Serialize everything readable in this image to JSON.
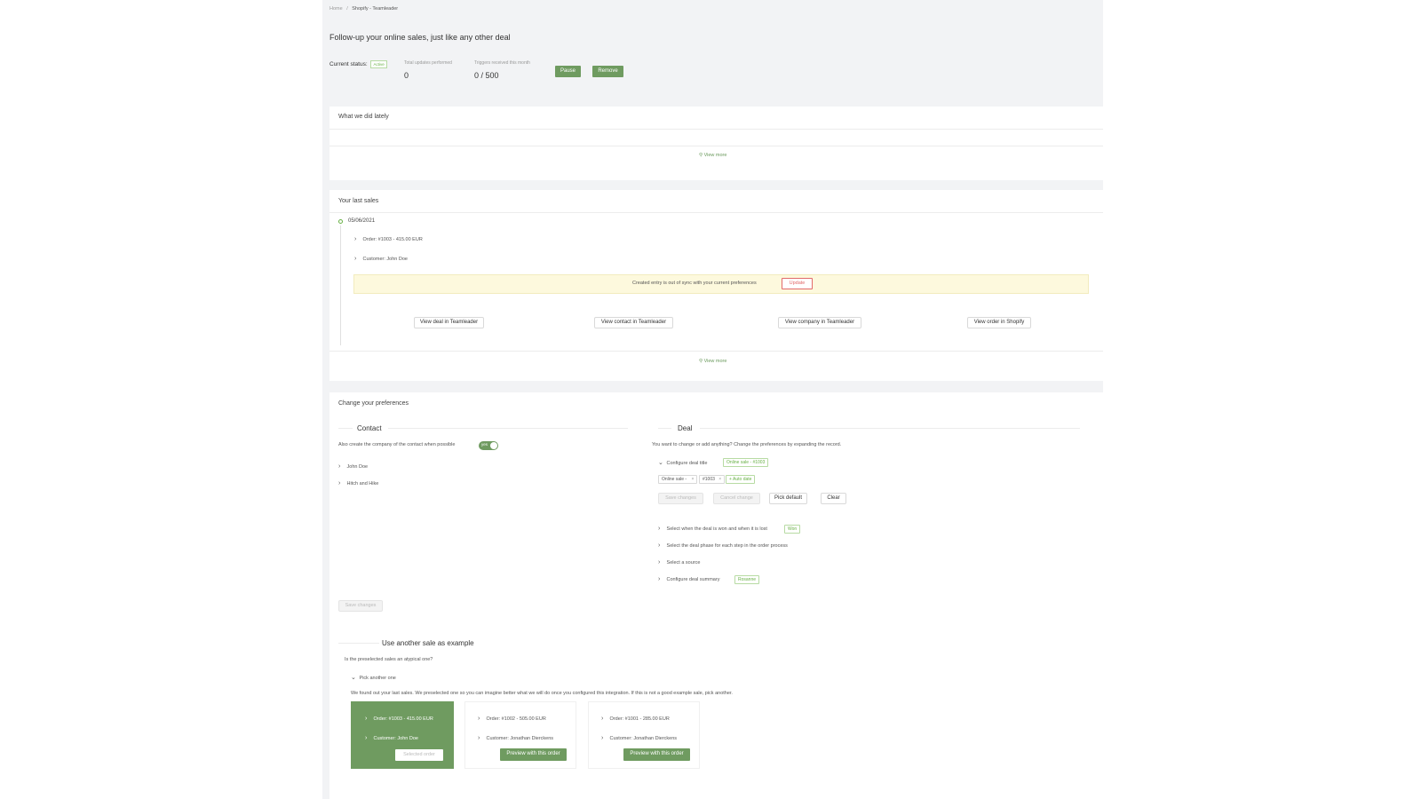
{
  "breadcrumb": {
    "home": "Home",
    "sep": "/",
    "current": "Shopify - Teamleader"
  },
  "page_title": "Follow-up your online sales, just like any other deal",
  "status": {
    "label": "Current status:",
    "badge": "Active",
    "updates_label": "Total updates performed",
    "updates_value": "0",
    "triggers_label": "Triggers received this month",
    "triggers_value": "0 / 500",
    "pause_button": "Pause",
    "remove_button": "Remove"
  },
  "recent": {
    "title": "What we did lately",
    "view_more": "View more"
  },
  "sales": {
    "title": "Your last sales",
    "date": "05/06/2021",
    "order": "Order: #1003 - 415.00 EUR",
    "customer": "Customer: John Doe",
    "sync_warning": "Created entry is out of sync with your current preferences",
    "update_button": "Update",
    "view_deal": "View deal in Teamleader",
    "view_contact": "View contact in Teamleader",
    "view_company": "View company in Teamleader",
    "view_order": "View order in Shopify",
    "view_more": "View more"
  },
  "prefs": {
    "title": "Change your preferences",
    "contact": {
      "heading": "Contact",
      "company_label": "Also create the company of the contact when possible",
      "toggle_label": "yes",
      "items": [
        "John Doe",
        "Hitch and Hike"
      ]
    },
    "deal": {
      "heading": "Deal",
      "intro": "You want to change or add anything? Change the preferences by expanding the record.",
      "configure_title": "Configure deal title",
      "title_tag": "Online sale - #1003",
      "chip1": "Online sale -",
      "chip2": "#1003",
      "add_tag": "+ Auto date",
      "save_changes": "Save changes",
      "cancel_changes": "Cancel change",
      "pick_default": "Pick default",
      "clear": "Clear",
      "won_lost": "Select when the deal is won and when it is lost",
      "won_tag": "Won",
      "phase": "Select the deal phase for each step in the order process",
      "source": "Select a source",
      "summary": "Configure deal summary",
      "summary_tag": "Rosanne"
    },
    "save_button": "Save changes"
  },
  "example": {
    "heading": "Use another sale as example",
    "question": "Is the preselected sales an atypical one?",
    "pick": "Pick another one",
    "explanation": "We found out your last sales. We preselected one so you can imagine better what we will do once you configured this integration. If this is not a good example sale, pick another.",
    "orders": [
      {
        "order": "Order: #1003 - 415.00 EUR",
        "customer": "Customer: John Doe",
        "button": "Selected order"
      },
      {
        "order": "Order: #1002 - 505.00 EUR",
        "customer": "Customer: Jonathan Dierckens",
        "button": "Preview with this order"
      },
      {
        "order": "Order: #1001 - 285.00 EUR",
        "customer": "Customer: Jonathan Dierckens",
        "button": "Preview with this order"
      }
    ]
  },
  "colors": {
    "accent": "#6f9b60",
    "active_badge": "#68b045",
    "warning_bg": "#fdf9dd",
    "update_red": "#e26a6a"
  },
  "icons": {
    "view_more": "search-icon",
    "chevron": "chevron-right-icon",
    "chevron_open": "chevron-down-icon"
  }
}
